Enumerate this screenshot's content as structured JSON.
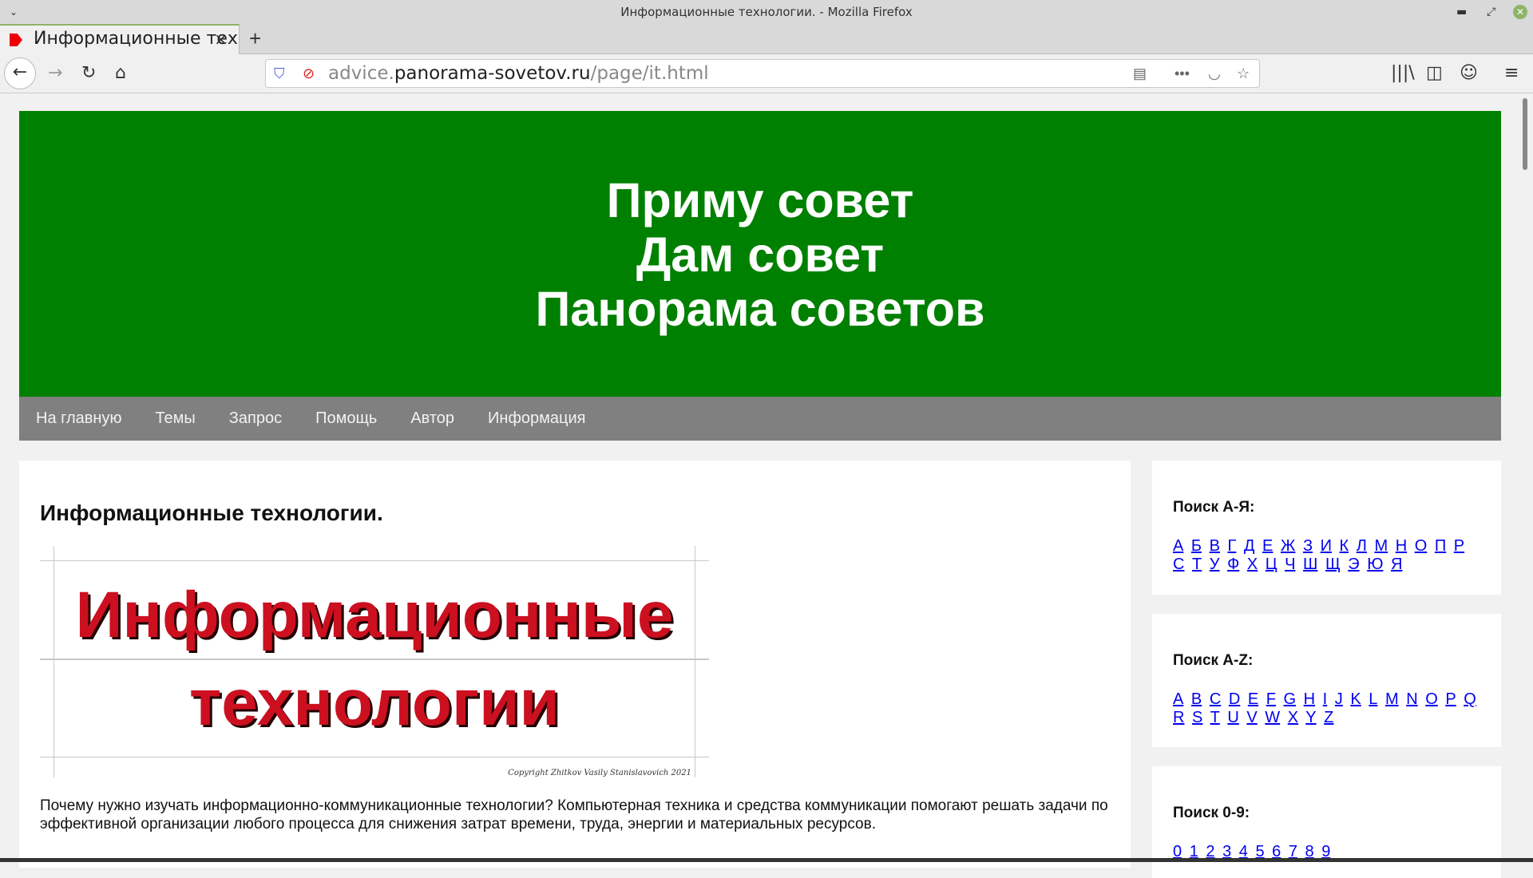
{
  "window": {
    "title": "Информационные технологии. - Mozilla Firefox"
  },
  "tab": {
    "label": "Информационные технологии.",
    "close": "×",
    "new": "+"
  },
  "url": {
    "prefix": "advice.",
    "domain": "panorama-sovetov.ru",
    "path": "/page/it.html"
  },
  "header": {
    "line1": "Приму совет",
    "line2": "Дам совет",
    "line3": "Панорама советов"
  },
  "nav": [
    "На главную",
    "Темы",
    "Запрос",
    "Помощь",
    "Автор",
    "Информация"
  ],
  "main": {
    "title": "Информационные технологии.",
    "banner": {
      "line1": "Информационные",
      "line2": "технологии",
      "copyright": "Copyright Zhitkov Vasily Stanislavovich 2021"
    },
    "paragraph": "Почему нужно изучать информационно-коммуникационные технологии? Компьютерная техника и средства коммуникации помогают решать задачи по эффективной организации любого процесса для снижения затрат времени, труда, энергии и материальных ресурсов."
  },
  "sidebar": [
    {
      "title": "Поиск А-Я:",
      "letters": [
        "А",
        "Б",
        "В",
        "Г",
        "Д",
        "Е",
        "Ж",
        "З",
        "И",
        "К",
        "Л",
        "М",
        "Н",
        "О",
        "П",
        "Р",
        "С",
        "Т",
        "У",
        "Ф",
        "Х",
        "Ц",
        "Ч",
        "Ш",
        "Щ",
        "Э",
        "Ю",
        "Я"
      ]
    },
    {
      "title": "Поиск A-Z:",
      "letters": [
        "A",
        "B",
        "C",
        "D",
        "E",
        "F",
        "G",
        "H",
        "I",
        "J",
        "K",
        "L",
        "M",
        "N",
        "O",
        "P",
        "Q",
        "R",
        "S",
        "T",
        "U",
        "V",
        "W",
        "X",
        "Y",
        "Z"
      ]
    },
    {
      "title": "Поиск 0-9:",
      "letters": [
        "0",
        "1",
        "2",
        "3",
        "4",
        "5",
        "6",
        "7",
        "8",
        "9"
      ]
    }
  ],
  "colors": {
    "header": "#008000",
    "nav": "#808080",
    "banner_text": "#cc1020",
    "link": "#0000ee"
  }
}
